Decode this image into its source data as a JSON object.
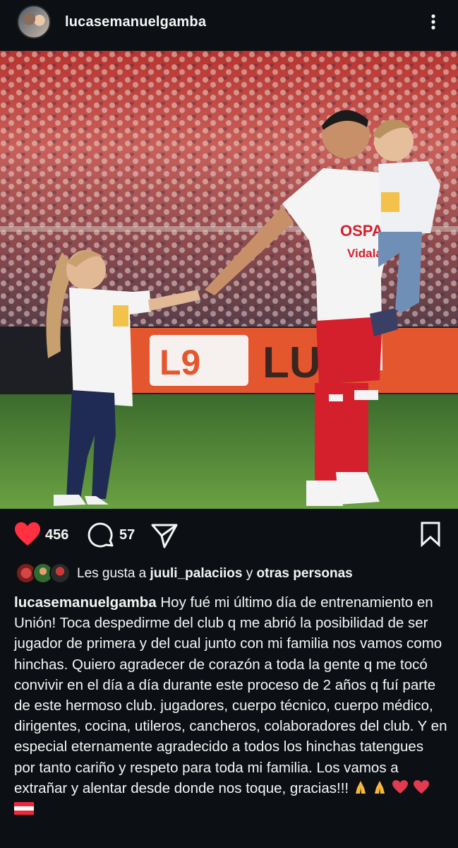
{
  "post": {
    "username": "lucasemanuelgamba",
    "more_icon": "more-vertical-icon"
  },
  "photo": {
    "alt": "Player walking on the pitch holding a child with another child beside him",
    "board_text": "L9 LUSO"
  },
  "actions": {
    "like_count": "456",
    "comment_count": "57",
    "like_icon": "heart-icon",
    "like_color": "#ff3040",
    "comment_icon": "comment-icon",
    "share_icon": "send-icon",
    "save_icon": "bookmark-icon"
  },
  "likes": {
    "prefix": "Les gusta a ",
    "user": "juuli_palaciios",
    "middle": " y ",
    "others": "otras personas"
  },
  "caption": {
    "username": "lucasemanuelgamba",
    "text": "Hoy fué mi último día de entrenamiento en Unión! Toca despedirme del club q me abrió la posibilidad de ser jugador de primera y del cual junto con mi familia nos vamos como hinchas. Quiero agradecer de corazón a toda la gente q me tocó convivir en el día a día durante este proceso de 2 años q fuí parte de este hermoso club. jugadores, cuerpo técnico, cuerpo médico, dirigentes, cocina, utileros, cancheros, colaboradores del club. Y en especial eternamente agradecido a todos los hinchas tatengues por tanto cariño y respeto para toda mi familia. Los vamos a extrañar y alentar desde donde nos toque, gracias!!! ",
    "emojis": [
      "pray-emoji",
      "pray-emoji",
      "red-heart-emoji",
      "red-heart-emoji",
      "austria-flag-emoji"
    ]
  }
}
